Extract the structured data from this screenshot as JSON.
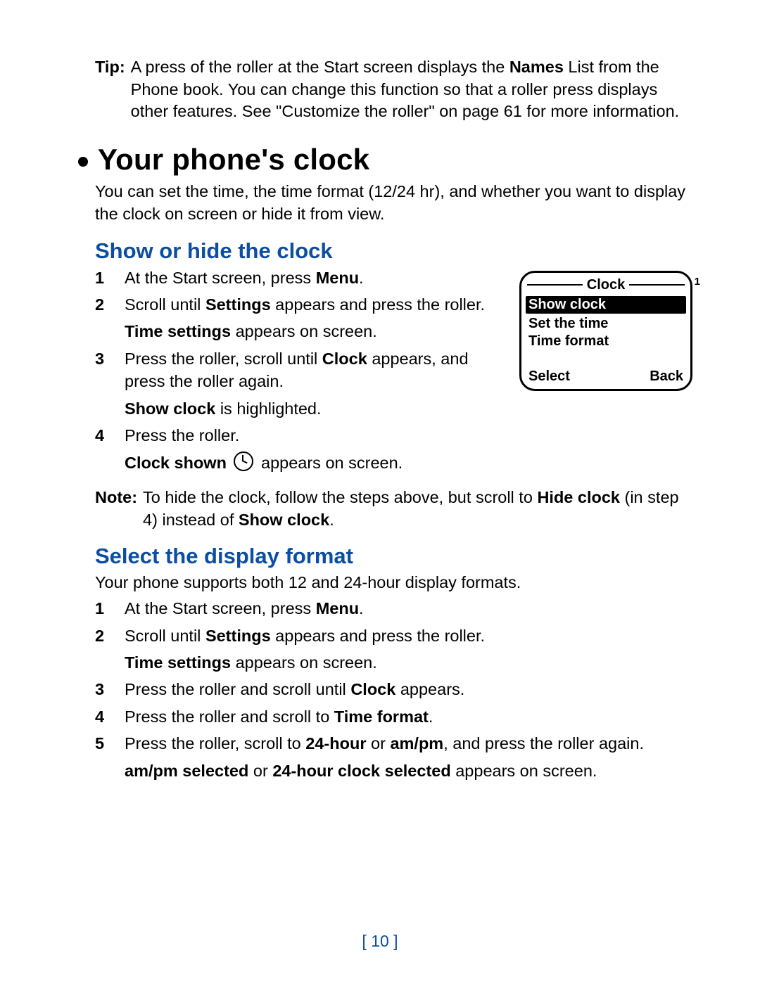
{
  "tip": {
    "label": "Tip:",
    "text_pre": "A press of the roller at the Start screen displays the ",
    "bold1": "Names",
    "text_post": " List from the Phone book. You can change this function so that a roller press displays other features. See \"Customize the roller\" on page 61 for more information."
  },
  "h1": "Your phone's clock",
  "intro": "You can set the time, the time format (12/24 hr), and whether you want to display the clock on screen or hide it from view.",
  "section1": {
    "heading": "Show or hide the clock",
    "steps": {
      "s1": {
        "num": "1",
        "pre": "At the Start screen, press ",
        "b1": "Menu",
        "post": "."
      },
      "s2": {
        "num": "2",
        "pre": "Scroll until ",
        "b1": "Settings",
        "post": " appears and press the roller.",
        "sub_b": "Time settings",
        "sub_post": " appears on screen."
      },
      "s3": {
        "num": "3",
        "pre": "Press the roller, scroll until ",
        "b1": "Clock",
        "post": " appears, and press the roller again.",
        "sub_b": "Show clock",
        "sub_post": " is highlighted."
      },
      "s4": {
        "num": "4",
        "text": "Press the roller.",
        "sub_b": "Clock shown",
        "sub_post": " appears on screen."
      }
    },
    "note": {
      "label": "Note:",
      "pre": "To hide the clock, follow the steps above, but scroll to ",
      "b1": "Hide clock",
      "mid": " (in step 4) instead of ",
      "b2": "Show clock",
      "post": "."
    }
  },
  "phone_screen": {
    "title": "Clock",
    "signal": "1",
    "items": [
      "Show clock",
      "Set the time",
      "Time format"
    ],
    "soft_left": "Select",
    "soft_right": "Back"
  },
  "section2": {
    "heading": "Select the display format",
    "intro": "Your phone supports both 12 and 24-hour display formats.",
    "steps": {
      "s1": {
        "num": "1",
        "pre": "At the Start screen, press ",
        "b1": "Menu",
        "post": "."
      },
      "s2": {
        "num": "2",
        "pre": "Scroll until ",
        "b1": "Settings",
        "post": " appears and press the roller.",
        "sub_b": "Time settings",
        "sub_post": " appears on screen."
      },
      "s3": {
        "num": "3",
        "pre": "Press the roller and scroll until ",
        "b1": "Clock",
        "post": " appears."
      },
      "s4": {
        "num": "4",
        "pre": "Press the roller and scroll to ",
        "b1": "Time format",
        "post": "."
      },
      "s5": {
        "num": "5",
        "pre": "Press the roller, scroll to ",
        "b1": "24-hour",
        "mid": " or ",
        "b2": "am/pm",
        "post": ", and press the roller again.",
        "sub_b1": "am/pm selected",
        "sub_mid": " or ",
        "sub_b2": "24-hour clock selected",
        "sub_post": " appears on screen."
      }
    }
  },
  "page_number": "[ 10 ]"
}
